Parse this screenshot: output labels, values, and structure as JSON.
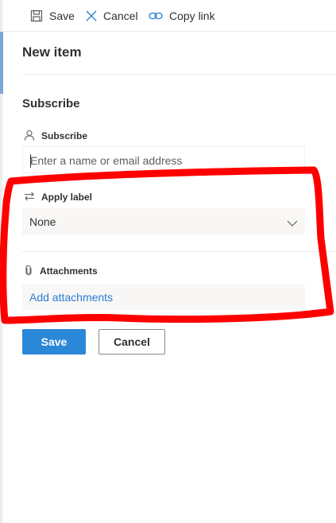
{
  "command_bar": {
    "save_label": "Save",
    "cancel_label": "Cancel",
    "copy_link_label": "Copy link"
  },
  "form": {
    "title": "New item",
    "section_heading": "Subscribe",
    "subscribe_label": "Subscribe",
    "subscribe_placeholder": "Enter a name or email address",
    "apply_label_label": "Apply label",
    "apply_label_value": "None",
    "attachments_label": "Attachments",
    "add_attachments_link": "Add attachments"
  },
  "footer": {
    "save_label": "Save",
    "cancel_label": "Cancel"
  },
  "icons": {
    "save": "save-icon",
    "cancel": "close-icon",
    "copy_link": "link-icon",
    "person": "person-icon",
    "apply_label": "swap-arrows-icon",
    "dropdown": "chevron-down-icon",
    "attachment": "paperclip-icon"
  },
  "colors": {
    "primary_button": "#2b88d8",
    "link": "#2b7bd6",
    "annotation": "#ff0000"
  }
}
